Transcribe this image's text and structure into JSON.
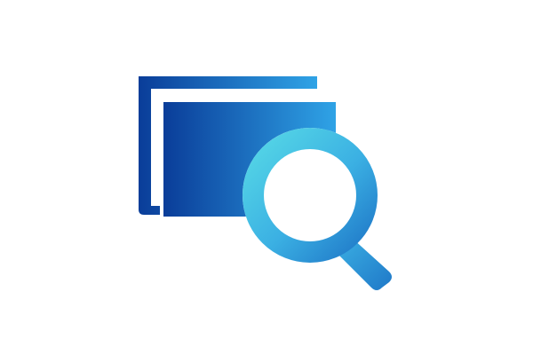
{
  "icon": {
    "name": "folder-search-icon",
    "colors": {
      "folder_dark": "#0A3D99",
      "folder_light": "#2FA3E6",
      "magnifier_light": "#55D7E6",
      "magnifier_mid": "#3BB0E3",
      "magnifier_dark": "#1F78C8"
    }
  }
}
